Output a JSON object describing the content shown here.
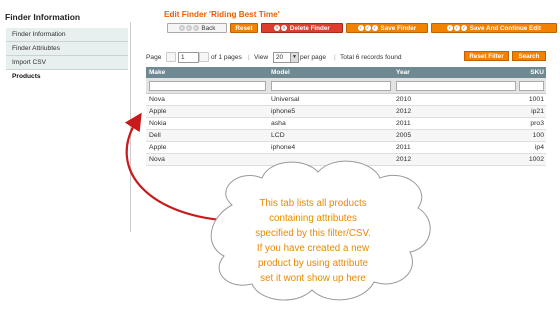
{
  "sidebar": {
    "title": "Finder Information",
    "items": [
      {
        "label": "Finder Information"
      },
      {
        "label": "Finder Attriubtes"
      },
      {
        "label": "Import CSV"
      },
      {
        "label": "Products"
      }
    ]
  },
  "header": {
    "title": "Edit Finder 'Riding Best Time'",
    "back_label": "Back",
    "reset_label": "Reset",
    "delete_label": "Delete Finder",
    "save_label": "Save Finder",
    "save_continue_label": "Save And Continue Edit"
  },
  "pager": {
    "page_label": "Page",
    "page_value": "1",
    "of_pages": "of 1 pages",
    "view_label": "View",
    "per_page_value": "20",
    "per_page_label": "per page",
    "total": "Total 6 records found",
    "reset_filter_label": "Reset Filter",
    "search_label": "Search"
  },
  "grid": {
    "columns": [
      "Make",
      "Model",
      "Year",
      "SKU"
    ],
    "rows": [
      [
        "Nova",
        "Universal",
        "2010",
        "1001"
      ],
      [
        "Apple",
        "iphone5",
        "2012",
        "ip21"
      ],
      [
        "Nokia",
        "asha",
        "2011",
        "pro3"
      ],
      [
        "Dell",
        "LCD",
        "2005",
        "100"
      ],
      [
        "Apple",
        "iphone4",
        "2011",
        "ip4"
      ],
      [
        "Nova",
        "",
        "2012",
        "1002"
      ]
    ]
  },
  "callout": {
    "lines": [
      "This tab lists all products",
      "containing attributes",
      "specified by this filter/CSV.",
      "If you have created a new",
      "product by using attribute",
      "set it wont show up here"
    ]
  },
  "colors": {
    "accent": "#eb5e00",
    "button": "#f18200",
    "delete": "#dd3d2d",
    "grid_header": "#6f8992",
    "callout": "#e98a00",
    "arrow": "#c81a1a"
  }
}
